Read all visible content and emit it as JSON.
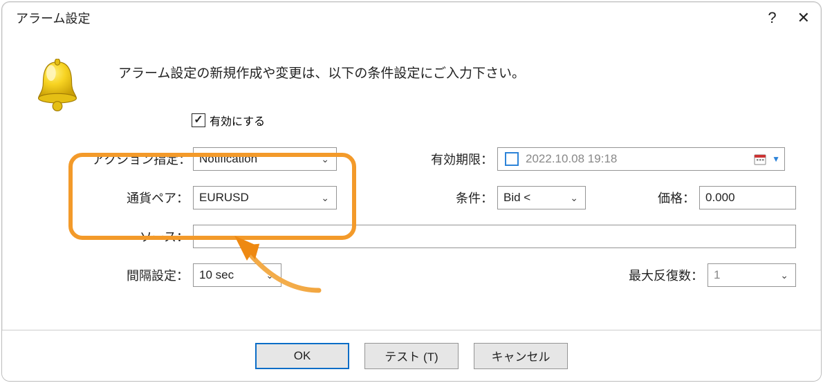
{
  "window": {
    "title": "アラーム設定"
  },
  "intro": "アラーム設定の新規作成や変更は、以下の条件設定にご入力下さい。",
  "fields": {
    "enable": {
      "label": "有効にする",
      "checked": true
    },
    "action": {
      "label": "アクション指定：",
      "value": "Notification"
    },
    "symbol": {
      "label": "通貨ペア：",
      "value": "EURUSD"
    },
    "source": {
      "label": "ソース：",
      "value": ""
    },
    "interval": {
      "label": "間隔設定：",
      "value": "10 sec"
    },
    "expiry": {
      "label": "有効期限：",
      "value": "2022.10.08 19:18",
      "checked": false
    },
    "condition": {
      "label": "条件：",
      "value": "Bid <"
    },
    "price": {
      "label": "価格：",
      "value": "0.000"
    },
    "maxrep": {
      "label": "最大反復数：",
      "value": "1"
    }
  },
  "buttons": {
    "ok": "OK",
    "test": "テスト (T)",
    "cancel": "キャンセル"
  }
}
